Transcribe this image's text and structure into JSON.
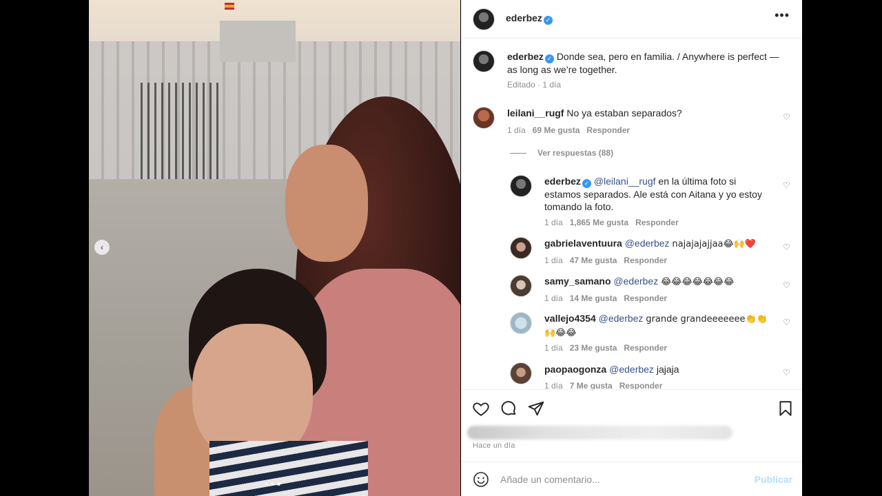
{
  "post": {
    "username": "ederbez",
    "caption": "Donde sea, pero en familia. / Anywhere is perfect — as long as we’re together.",
    "edited": "Editado · 1 día"
  },
  "comments": [
    {
      "user": "leilani__rugf",
      "text": "No ya estaban separados?",
      "time": "1 día",
      "likes": "69 Me gusta",
      "reply": "Responder"
    }
  ],
  "view_replies": "Ver respuestas (88)",
  "replies": [
    {
      "user": "ederbez",
      "verified": true,
      "mention": "@leilani__rugf",
      "text": "en la última foto si estamos separados. Ale está con Aitana y yo estoy tomando la foto.",
      "time": "1 día",
      "likes": "1,865 Me gusta",
      "reply": "Responder"
    },
    {
      "user": "gabrielaventuura",
      "mention": "@ederbez",
      "text": "najajajajjaa😂🙌❤️",
      "time": "1 día",
      "likes": "47 Me gusta",
      "reply": "Responder"
    },
    {
      "user": "samy_samano",
      "mention": "@ederbez",
      "text": "😂😂😂😂😂😂😂",
      "time": "1 día",
      "likes": "14 Me gusta",
      "reply": "Responder"
    },
    {
      "user": "vallejo4354",
      "mention": "@ederbez",
      "text": "grande grandeeeeeee👏👏🙌😂😂",
      "time": "1 día",
      "likes": "23 Me gusta",
      "reply": "Responder"
    },
    {
      "user": "paopaogonza",
      "mention": "@ederbez",
      "text": "jajaja",
      "time": "1 día",
      "likes": "7 Me gusta",
      "reply": "Responder"
    }
  ],
  "footer": {
    "time_ago": "Hace un día",
    "comment_placeholder": "Añade un comentario...",
    "publish_label": "Publicar"
  },
  "icons": {
    "like": "heart-icon",
    "comment": "comment-icon",
    "share": "send-icon",
    "save": "bookmark-icon",
    "emoji": "smiley-icon",
    "more": "more-icon",
    "prev": "chevron-left-icon"
  },
  "colors": {
    "verified": "#3897f0",
    "mention": "#385185",
    "publish": "#b2dffc"
  }
}
